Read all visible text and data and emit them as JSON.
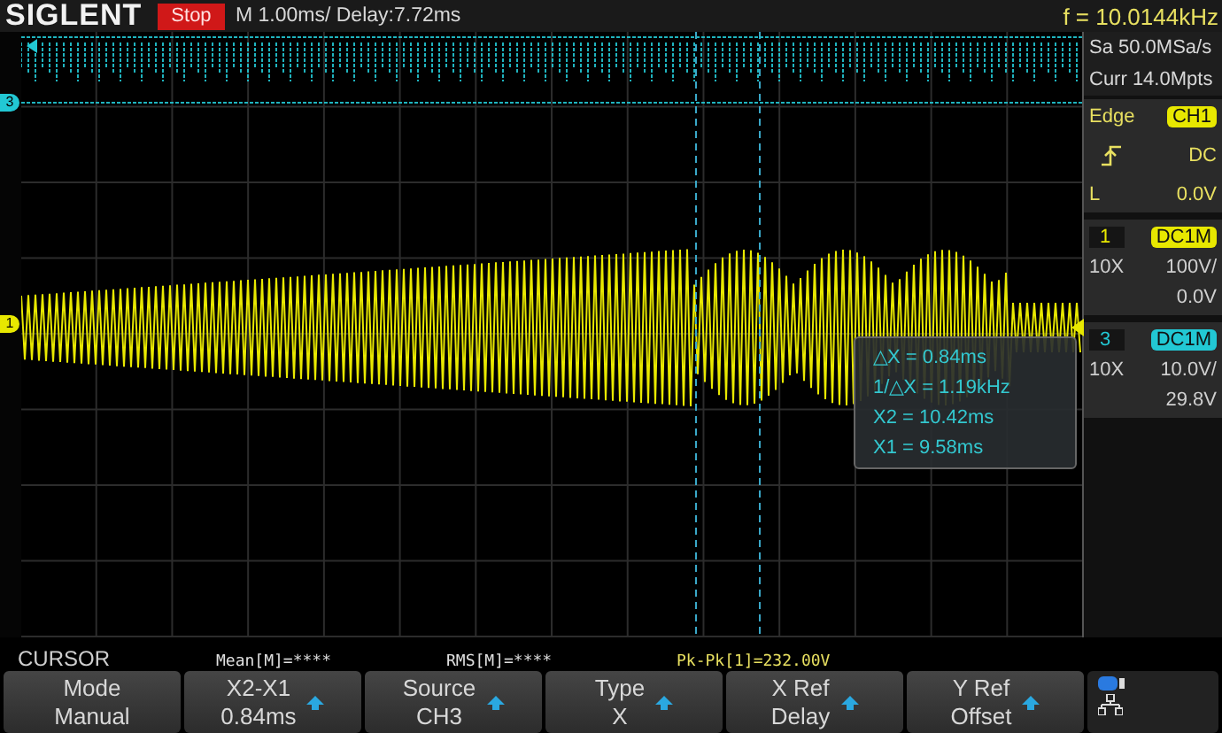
{
  "header": {
    "brand": "SIGLENT",
    "run_state": "Stop",
    "timebase": "M 1.00ms/ Delay:7.72ms",
    "frequency": "f = 10.0144kHz"
  },
  "acquisition": [
    "Sa 50.0MSa/s",
    "Curr 14.0Mpts"
  ],
  "trigger": {
    "type": "Edge",
    "source": "CH1",
    "coupling": "DC",
    "level_label": "L",
    "trigger_level": "0.0V"
  },
  "channels": [
    {
      "number": "1",
      "coupling": "DC1M",
      "probe": "10X",
      "scale": "100V/",
      "offset": "0.0V",
      "color": "#e8e800"
    },
    {
      "number": "3",
      "coupling": "DC1M",
      "probe": "10X",
      "scale": "10.0V/",
      "offset": "29.8V",
      "color": "#22c8d4"
    }
  ],
  "trace_markers": [
    {
      "label": "3",
      "color": "#22c8d4"
    },
    {
      "label": "1",
      "color": "#e8e800"
    }
  ],
  "cursor_readout": [
    "△X = 0.84ms",
    "1/△X = 1.19kHz",
    "X2 = 10.42ms",
    "X1 = 9.58ms"
  ],
  "measurements": [
    {
      "text": "Mean[M]=****",
      "color": "#e0e0e0"
    },
    {
      "text": "RMS[M]=****",
      "color": "#e0e0e0"
    },
    {
      "text": "Pk-Pk[1]=232.00V",
      "color": "#e8e060"
    }
  ],
  "menu": {
    "title": "CURSOR",
    "softkeys": [
      {
        "top": "Mode",
        "bottom": "Manual",
        "arrow": false
      },
      {
        "top": "X2-X1",
        "bottom": "0.84ms",
        "arrow": true
      },
      {
        "top": "Source",
        "bottom": "CH3",
        "arrow": true
      },
      {
        "top": "Type",
        "bottom": "X",
        "arrow": true
      },
      {
        "top": "X Ref",
        "bottom": "Delay",
        "arrow": true
      },
      {
        "top": "Y Ref",
        "bottom": "Offset",
        "arrow": true
      }
    ]
  }
}
